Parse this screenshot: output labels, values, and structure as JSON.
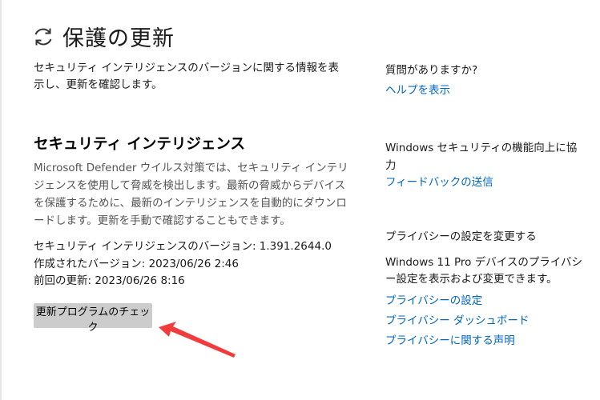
{
  "header": {
    "icon": "refresh-icon",
    "title": "保護の更新"
  },
  "intro": {
    "text": "セキュリティ インテリジェンスのバージョンに関する情報を表示し、更新を確認します。"
  },
  "section": {
    "title": "セキュリティ インテリジェンス",
    "description": "Microsoft Defender ウイルス対策では、セキュリティ インテリジェンスを使用して脅威を検出します。最新の脅威からデバイスを保護するために、最新のインテリジェンスを自動的にダウンロードします。更新を手動で確認することもできます。",
    "version_line": "セキュリティ インテリジェンスのバージョン: 1.391.2644.0",
    "created_line": "作成されたバージョン: 2023/06/26 2:46",
    "last_update_line": "前回の更新: 2023/06/26 8:16",
    "check_button": "更新プログラムのチェック"
  },
  "sidebar": {
    "question": "質問がありますか?",
    "help_link": "ヘルプを表示",
    "improve_text": "Windows セキュリティの機能向上に協力",
    "feedback_link": "フィードバックの送信",
    "privacy_heading": "プライバシーの設定を変更する",
    "privacy_desc": "Windows 11 Pro デバイスのプライバシー設定を表示および変更できます。",
    "privacy_links": [
      "プライバシーの設定",
      "プライバシー ダッシュボード",
      "プライバシーに関する声明"
    ]
  },
  "colors": {
    "link": "#0067c0",
    "button_bg": "#cccccc",
    "annotation_arrow": "#f03c3c"
  }
}
